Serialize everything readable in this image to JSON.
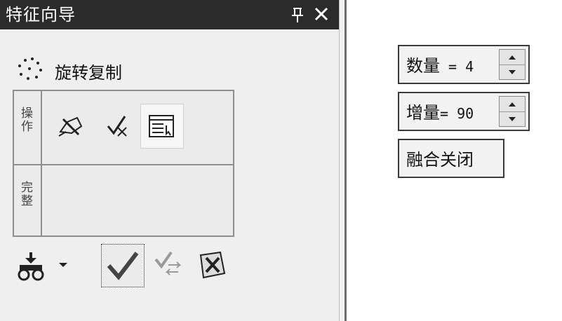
{
  "panel": {
    "title": "特征向导",
    "pin_glyph": "ꟼ",
    "close_glyph": "×",
    "feature_label": "旋转复制",
    "tab_1_label": "操作",
    "tab_2_label": "完整"
  },
  "right_controls": {
    "count": {
      "label": "数量",
      "eq": " = ",
      "value": "4"
    },
    "increment": {
      "label": "增量",
      "eq": "= ",
      "value": "90"
    },
    "blend": {
      "label": "融合关闭"
    }
  },
  "icons": {
    "feature": "rotate-copy-dots-icon",
    "tool_1": "edit-pen-icon",
    "tool_2": "select-check-icon",
    "tool_3": "properties-window-icon",
    "pick": "pick-binoculars-icon",
    "ok": "checkmark-icon",
    "apply": "apply-preview-icon",
    "cancel": "cancel-x-icon"
  }
}
